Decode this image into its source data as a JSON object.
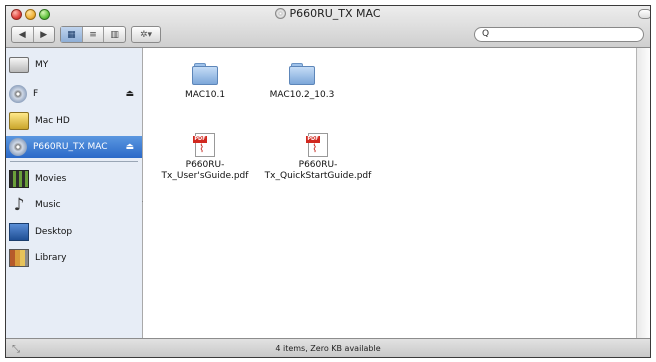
{
  "window": {
    "title": "P660RU_TX MAC"
  },
  "toolbar": {
    "back_label": "◀",
    "forward_label": "▶",
    "view_icon_label": "▦",
    "view_list_label": "≡",
    "view_column_label": "▥",
    "action_label": "✲▾",
    "search_icon": "Q"
  },
  "sidebar": {
    "items": [
      {
        "label": "MY",
        "icon": "drive-icon",
        "eject": ""
      },
      {
        "label": "F",
        "icon": "disc-icon",
        "eject": "⏏"
      },
      {
        "label": "Mac HD",
        "icon": "hard-disk-icon",
        "eject": ""
      },
      {
        "label": "P660RU_TX MAC",
        "icon": "disc-icon",
        "eject": "⏏",
        "selected": true
      },
      {
        "label": "Movies",
        "icon": "film-icon"
      },
      {
        "label": "Music",
        "icon": "music-note-icon"
      },
      {
        "label": "Desktop",
        "icon": "desktop-icon"
      },
      {
        "label": "Library",
        "icon": "library-icon"
      }
    ]
  },
  "files": [
    {
      "name": "MAC10.1",
      "type": "folder"
    },
    {
      "name": "MAC10.2_10.3",
      "type": "folder"
    },
    {
      "name_line1": "P660RU-",
      "name_line2": "Tx_User'sGuide.pdf",
      "type": "pdf",
      "badge": "PDF"
    },
    {
      "name_line1": "P660RU-",
      "name_line2": "Tx_QuickStartGuide.pdf",
      "type": "pdf",
      "badge": "PDF"
    }
  ],
  "status": {
    "text": "4 items, Zero KB available"
  }
}
